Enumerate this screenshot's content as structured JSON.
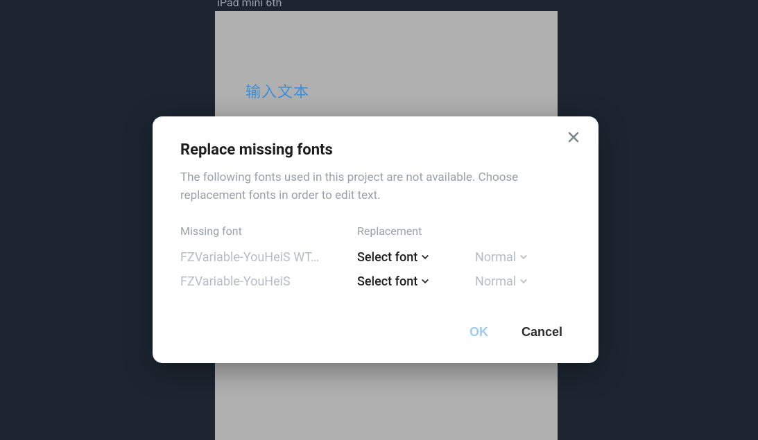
{
  "canvas": {
    "device_label": "iPad mini 6th",
    "placeholder_text": "输入文本"
  },
  "modal": {
    "title": "Replace missing fonts",
    "description": "The following fonts used in this project are not available. Choose replacement fonts in order to edit text.",
    "columns": {
      "missing": "Missing font",
      "replacement": "Replacement"
    },
    "rows": [
      {
        "missing": "FZVariable-YouHeiS WT…",
        "font_select": "Select font",
        "weight_select": "Normal"
      },
      {
        "missing": "FZVariable-YouHeiS",
        "font_select": "Select font",
        "weight_select": "Normal"
      }
    ],
    "actions": {
      "ok": "OK",
      "cancel": "Cancel"
    }
  }
}
